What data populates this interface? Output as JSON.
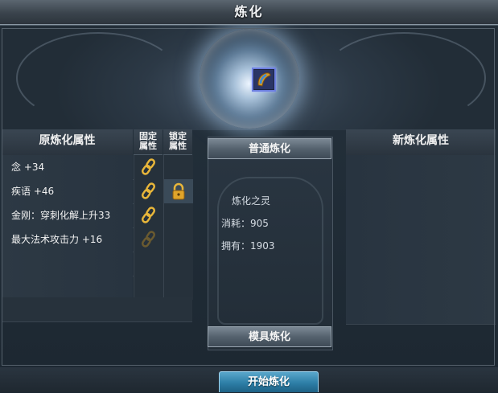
{
  "window": {
    "title": "炼化"
  },
  "left_table": {
    "header": "原炼化属性",
    "fixed_header": [
      "固定",
      "属性"
    ],
    "lock_header": [
      "锁定",
      "属性"
    ],
    "rows": [
      {
        "attr": "念 +34",
        "fixed_icon": "chain-link-icon",
        "lock_icon": ""
      },
      {
        "attr": "疾语 +46",
        "fixed_icon": "chain-link-icon",
        "lock_icon": "padlock-icon"
      },
      {
        "attr": "金刚：穿刺化解上升33",
        "fixed_icon": "chain-link-icon",
        "lock_icon": ""
      },
      {
        "attr": "最大法术攻击力 +16",
        "fixed_icon": "chain-link-dim-icon",
        "lock_icon": ""
      }
    ]
  },
  "right_table": {
    "header": "新炼化属性"
  },
  "center": {
    "mode_normal": "普通炼化",
    "material_name": "炼化之灵",
    "cost": "消耗：905",
    "owned": "拥有：1903",
    "mode_mold": "模具炼化"
  },
  "start_button": "开始炼化",
  "colors": {
    "chain_gold": "#e8b63a",
    "button_blue": "#2d7ea6",
    "slot_border": "#6d7fe0"
  }
}
